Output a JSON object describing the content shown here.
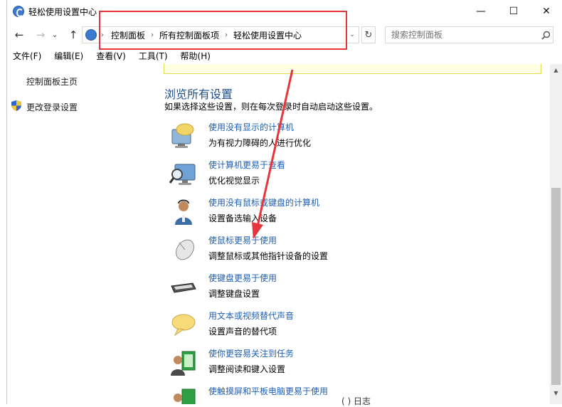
{
  "window": {
    "title": "轻松使用设置中心",
    "controls": {
      "minimize": "—",
      "maximize": "☐",
      "close": "✕"
    }
  },
  "nav": {
    "back": "←",
    "forward": "→",
    "dropdown": "⌄",
    "up": "↑",
    "breadcrumb": [
      "控制面板",
      "所有控制面板项",
      "轻松使用设置中心"
    ],
    "refresh": "↻",
    "search_placeholder": "搜索控制面板"
  },
  "menu": [
    "文件(F)",
    "编辑(E)",
    "查看(V)",
    "工具(T)",
    "帮助(H)"
  ],
  "sidebar": {
    "items": [
      {
        "label": "控制面板主页"
      },
      {
        "label": "更改登录设置",
        "icon": "shield-icon"
      }
    ]
  },
  "main": {
    "section_title": "浏览所有设置",
    "section_desc": "如果选择这些设置，则在每次登录时自动启动这些设置。",
    "items": [
      {
        "icon": "monitor-chat-icon",
        "link": "使用没有显示的计算机",
        "desc": "为有视力障碍的人进行优化"
      },
      {
        "icon": "magnifier-monitor-icon",
        "link": "使计算机更易于查看",
        "desc": "优化视觉显示"
      },
      {
        "icon": "person-headset-icon",
        "link": "使用没有鼠标或键盘的计算机",
        "desc": "设置备选输入设备"
      },
      {
        "icon": "mouse-icon",
        "link": "使鼠标更易于使用",
        "desc": "调整鼠标或其他指针设备的设置"
      },
      {
        "icon": "keyboard-icon",
        "link": "使键盘更易于使用",
        "desc": "调整键盘设置"
      },
      {
        "icon": "speech-bubble-icon",
        "link": "用文本或视频替代声音",
        "desc": "设置声音的替代项"
      },
      {
        "icon": "person-document-icon",
        "link": "使你更容易关注到任务",
        "desc": "调整阅读和键入设置"
      },
      {
        "icon": "person-tablet-icon",
        "link": "使触摸屏和平板电脑更易于使用",
        "desc": ""
      }
    ]
  },
  "scroll": {
    "up": "▲",
    "down": "▼"
  },
  "peek_text": "(  )  日志",
  "colors": {
    "highlight": "#e8343b",
    "link": "#1e5fb4",
    "title": "#1e4e8c"
  }
}
